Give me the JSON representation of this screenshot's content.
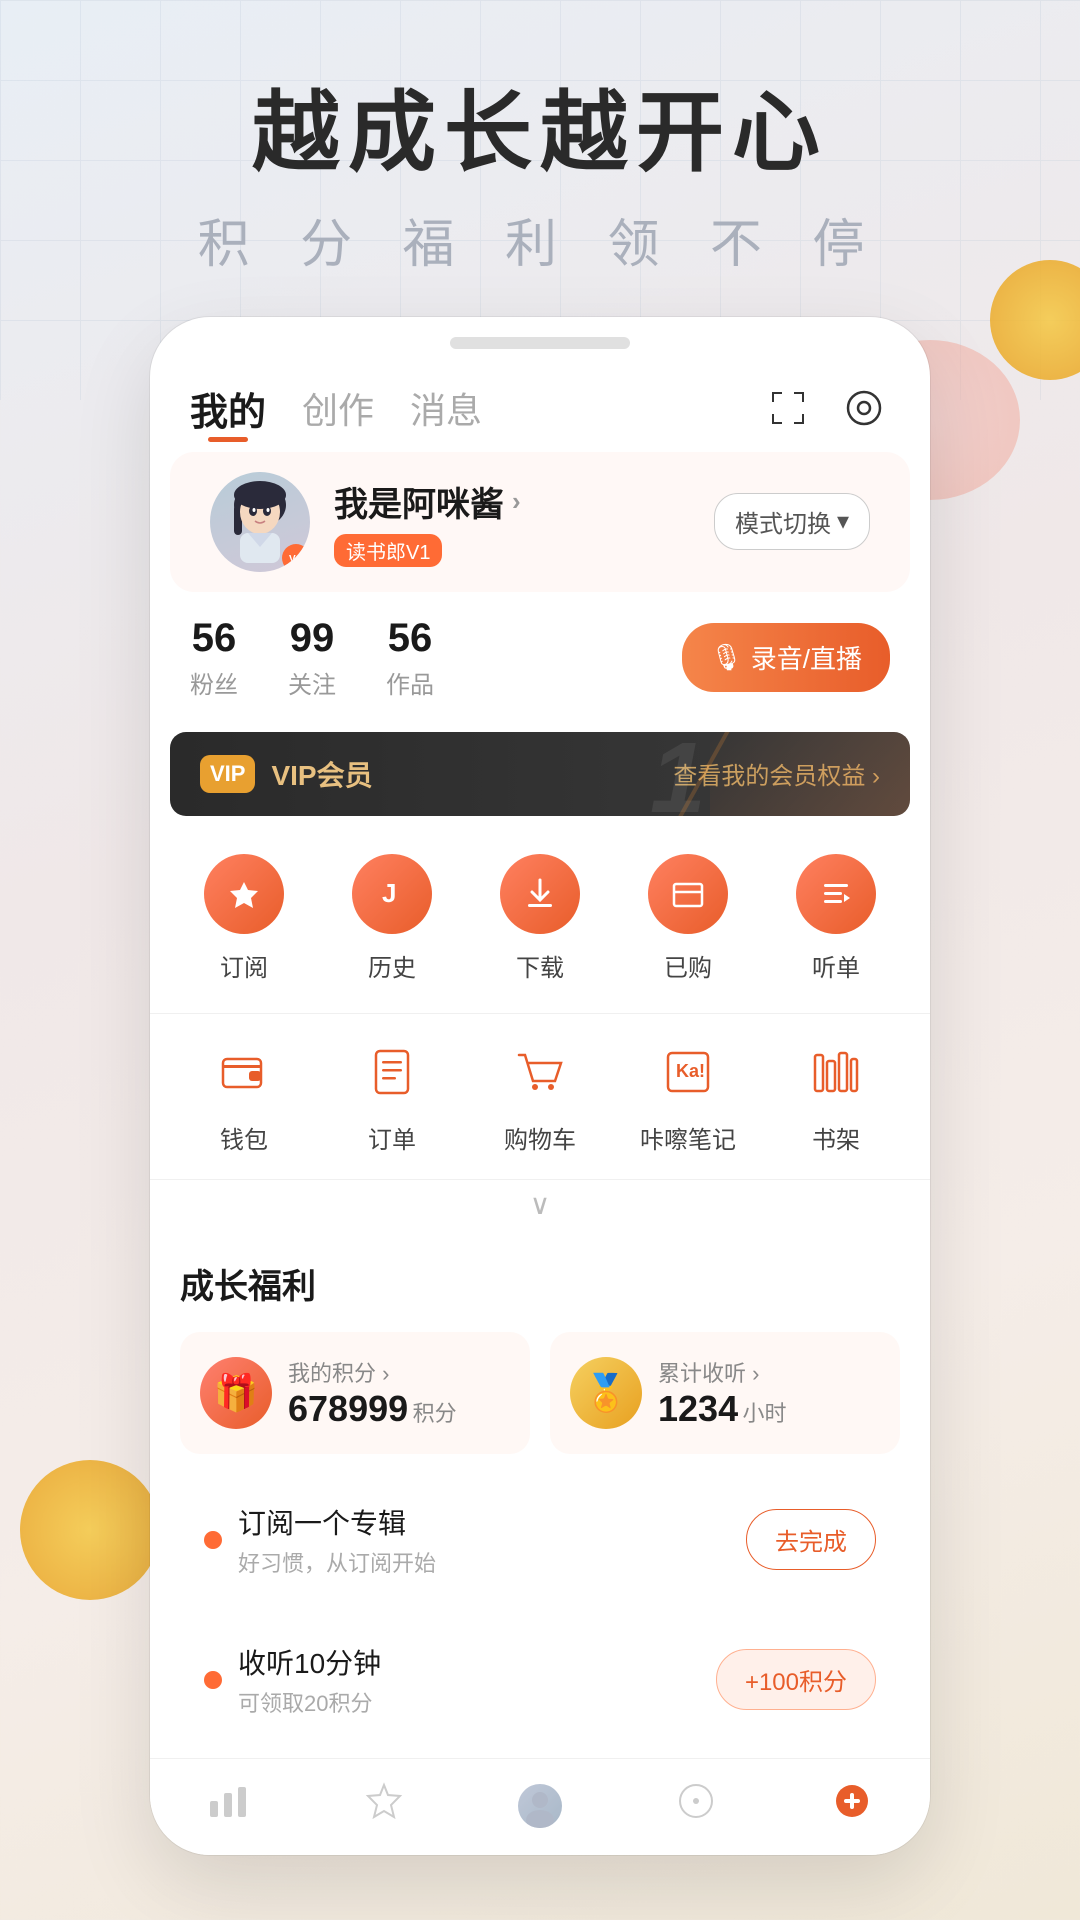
{
  "header": {
    "title": "越成长越开心",
    "subtitle": "积 分 福 利 领 不 停"
  },
  "nav": {
    "tabs": [
      {
        "label": "我的",
        "active": true
      },
      {
        "label": "创作",
        "active": false
      },
      {
        "label": "消息",
        "active": false
      }
    ],
    "icons": {
      "scan": "⊡",
      "settings": "◎"
    }
  },
  "profile": {
    "name": "我是阿咪酱",
    "arrow": "›",
    "tag": "读书郎V1",
    "mode_switch": "模式切换",
    "mode_switch_arrow": "▾",
    "stats": {
      "fans": {
        "count": "56",
        "label": "粉丝"
      },
      "following": {
        "count": "99",
        "label": "关注"
      },
      "works": {
        "count": "56",
        "label": "作品"
      }
    },
    "record_btn": "录音/直播",
    "mic_icon": "🎙"
  },
  "vip": {
    "icon_label": "VIP",
    "text": "VIP会员",
    "deco_number": "1",
    "rights_link": "查看我的会员权益 ›"
  },
  "quick_actions": [
    {
      "icon": "★",
      "label": "订阅"
    },
    {
      "icon": "J",
      "label": "历史"
    },
    {
      "icon": "↓",
      "label": "下载"
    },
    {
      "icon": "☐",
      "label": "已购"
    },
    {
      "icon": "≡",
      "label": "听单"
    }
  ],
  "tools": [
    {
      "icon": "👛",
      "label": "钱包"
    },
    {
      "icon": "📋",
      "label": "订单"
    },
    {
      "icon": "🛒",
      "label": "购物车"
    },
    {
      "icon": "Ka!",
      "label": "咔嚓笔记"
    },
    {
      "icon": "📚",
      "label": "书架"
    }
  ],
  "more_arrow": "∨",
  "welfare": {
    "section_title": "成长福利",
    "cards": [
      {
        "icon": "🎁",
        "icon_style": "pink",
        "top_label": "我的积分 ›",
        "number": "678999",
        "unit": "积分"
      },
      {
        "icon": "🏅",
        "icon_style": "yellow",
        "top_label": "累计收听 ›",
        "number": "1234",
        "unit": "小时"
      }
    ],
    "tasks": [
      {
        "title": "订阅一个专辑",
        "desc": "好习惯，从订阅开始",
        "btn_label": "去完成",
        "btn_style": "normal"
      },
      {
        "title": "收听10分钟",
        "desc": "可领取20积分",
        "btn_label": "+100积分",
        "btn_style": "points"
      }
    ]
  },
  "bottom_nav": [
    {
      "icon": "📊",
      "label": "",
      "active": false,
      "type": "chart"
    },
    {
      "icon": "☆",
      "label": "",
      "active": false,
      "type": "star"
    },
    {
      "icon": "avatar",
      "label": "",
      "active": false,
      "type": "avatar"
    },
    {
      "icon": "◎",
      "label": "",
      "active": false,
      "type": "compass"
    },
    {
      "icon": "🔴",
      "label": "",
      "active": false,
      "type": "red"
    }
  ]
}
